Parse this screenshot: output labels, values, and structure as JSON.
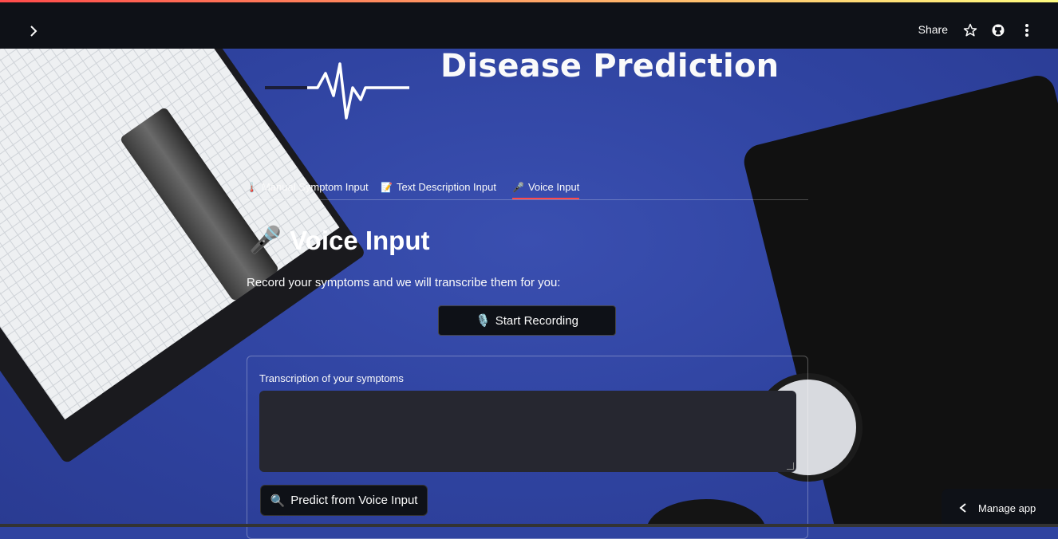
{
  "header": {
    "share_label": "Share",
    "icons": [
      "chevron-right-icon",
      "star-icon",
      "github-icon",
      "more-vertical-icon"
    ]
  },
  "app": {
    "title": "Disease Prediction"
  },
  "tabs": [
    {
      "icon": "🌡️",
      "label": "Manual Symptom Input",
      "active": false
    },
    {
      "icon": "📝",
      "label": "Text Description Input",
      "active": false
    },
    {
      "icon": "🎤",
      "label": "Voice Input",
      "active": true
    }
  ],
  "section": {
    "icon": "🎤",
    "title": "Voice Input",
    "description": "Record your symptoms and we will transcribe them for you:"
  },
  "record_button": {
    "icon": "🎙️",
    "label": "Start Recording"
  },
  "form": {
    "field_label": "Transcription of your symptoms",
    "field_value": "",
    "predict_icon": "🔍",
    "predict_label": "Predict from Voice Input"
  },
  "footer": {
    "manage_label": "Manage app"
  },
  "colors": {
    "header_bg": "#0e1117",
    "accent": "#ff4b4b",
    "background": "#2f43a0",
    "input_bg": "#262730"
  }
}
